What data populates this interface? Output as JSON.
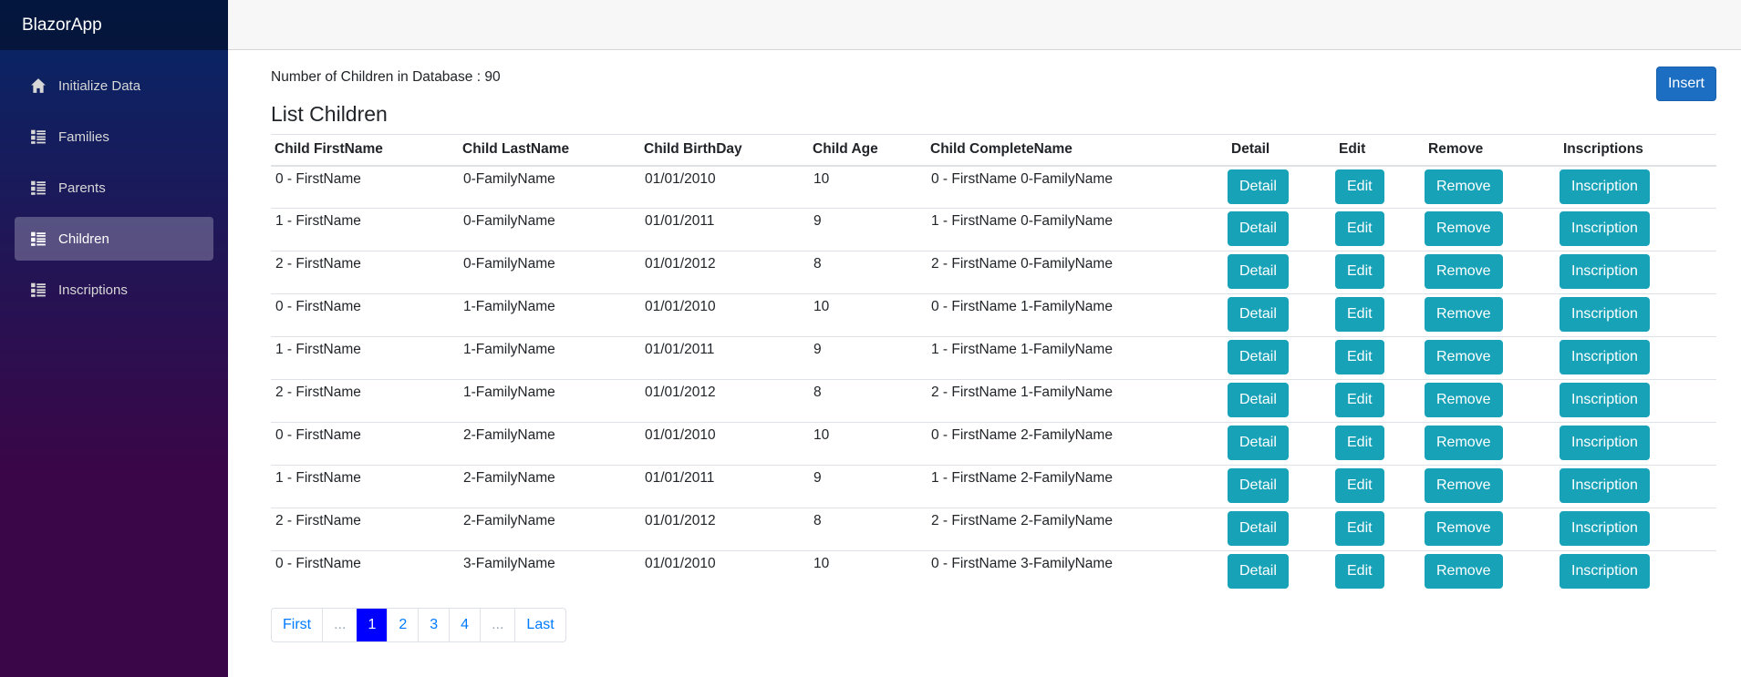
{
  "brand": "BlazorApp",
  "nav": [
    {
      "label": "Initialize Data",
      "icon": "home-icon",
      "active": false
    },
    {
      "label": "Families",
      "icon": "list-icon",
      "active": false
    },
    {
      "label": "Parents",
      "icon": "list-icon",
      "active": false
    },
    {
      "label": "Children",
      "icon": "list-icon",
      "active": true
    },
    {
      "label": "Inscriptions",
      "icon": "list-icon",
      "active": false
    }
  ],
  "count_label": "Number of Children in Database : 90",
  "insert_label": "Insert",
  "list_title": "List Children",
  "table": {
    "headers": [
      "Child FirstName",
      "Child LastName",
      "Child BirthDay",
      "Child Age",
      "Child CompleteName",
      "Detail",
      "Edit",
      "Remove",
      "Inscriptions"
    ],
    "rows": [
      [
        "0 - FirstName",
        "0-FamilyName",
        "01/01/2010",
        "10",
        "0 - FirstName 0-FamilyName"
      ],
      [
        "1 - FirstName",
        "0-FamilyName",
        "01/01/2011",
        "9",
        "1 - FirstName 0-FamilyName"
      ],
      [
        "2 - FirstName",
        "0-FamilyName",
        "01/01/2012",
        "8",
        "2 - FirstName 0-FamilyName"
      ],
      [
        "0 - FirstName",
        "1-FamilyName",
        "01/01/2010",
        "10",
        "0 - FirstName 1-FamilyName"
      ],
      [
        "1 - FirstName",
        "1-FamilyName",
        "01/01/2011",
        "9",
        "1 - FirstName 1-FamilyName"
      ],
      [
        "2 - FirstName",
        "1-FamilyName",
        "01/01/2012",
        "8",
        "2 - FirstName 1-FamilyName"
      ],
      [
        "0 - FirstName",
        "2-FamilyName",
        "01/01/2010",
        "10",
        "0 - FirstName 2-FamilyName"
      ],
      [
        "1 - FirstName",
        "2-FamilyName",
        "01/01/2011",
        "9",
        "1 - FirstName 2-FamilyName"
      ],
      [
        "2 - FirstName",
        "2-FamilyName",
        "01/01/2012",
        "8",
        "2 - FirstName 2-FamilyName"
      ],
      [
        "0 - FirstName",
        "3-FamilyName",
        "01/01/2010",
        "10",
        "0 - FirstName 3-FamilyName"
      ]
    ],
    "row_buttons": {
      "detail": "Detail",
      "edit": "Edit",
      "remove": "Remove",
      "inscription": "Inscription"
    }
  },
  "pager": [
    {
      "label": "First",
      "kind": "link"
    },
    {
      "label": "...",
      "kind": "ellipsis"
    },
    {
      "label": "1",
      "kind": "current"
    },
    {
      "label": "2",
      "kind": "link"
    },
    {
      "label": "3",
      "kind": "link"
    },
    {
      "label": "4",
      "kind": "link"
    },
    {
      "label": "...",
      "kind": "ellipsis"
    },
    {
      "label": "Last",
      "kind": "link"
    }
  ],
  "colors": {
    "accent": "#1b6ec2",
    "action": "#17a2b8",
    "current_page": "#0000ff",
    "link": "#007bff"
  }
}
